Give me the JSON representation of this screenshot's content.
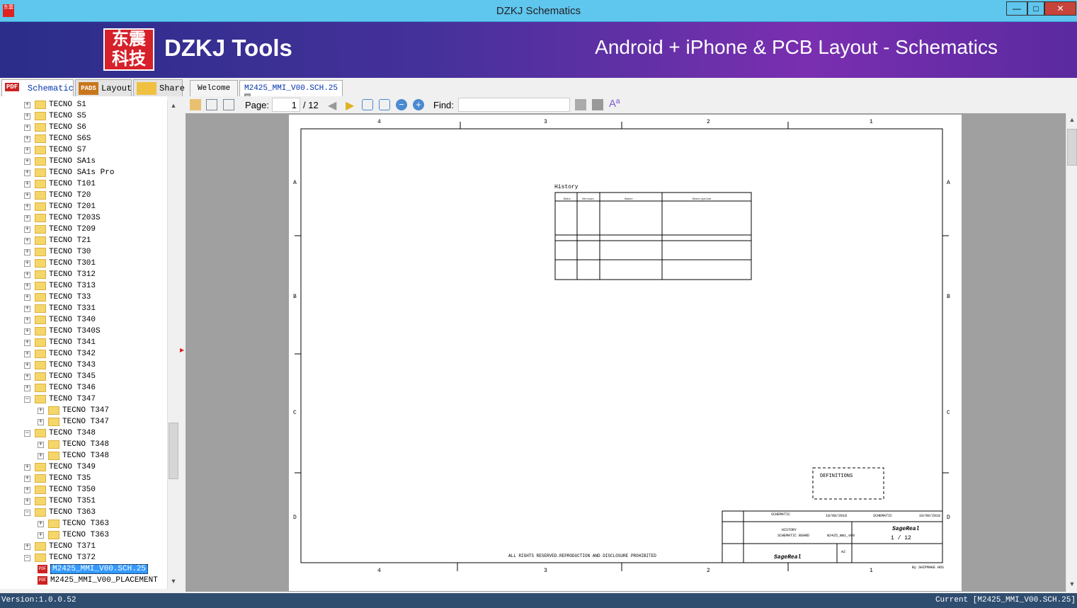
{
  "window": {
    "title": "DZKJ Schematics",
    "minimize": "—",
    "maximize": "□",
    "close": "✕"
  },
  "banner": {
    "logo_text": "东震科技",
    "brand": "DZKJ Tools",
    "tagline": "Android + iPhone & PCB Layout - Schematics"
  },
  "left_tabs": [
    {
      "label": "Schematic",
      "icon": "PDF"
    },
    {
      "label": "Layout",
      "icon": "PADS"
    },
    {
      "label": "Share",
      "icon": "cloud-plus"
    }
  ],
  "doc_tabs": [
    {
      "label": "Welcome"
    },
    {
      "label": "M2425_MMI_V00.SCH.25"
    }
  ],
  "tree": [
    {
      "label": "TECNO S1",
      "level": 0,
      "state": "+"
    },
    {
      "label": "TECNO S5",
      "level": 0,
      "state": "+"
    },
    {
      "label": "TECNO S6",
      "level": 0,
      "state": "+"
    },
    {
      "label": "TECNO S6S",
      "level": 0,
      "state": "+"
    },
    {
      "label": "TECNO S7",
      "level": 0,
      "state": "+"
    },
    {
      "label": "TECNO SA1s",
      "level": 0,
      "state": "+"
    },
    {
      "label": "TECNO SA1s Pro",
      "level": 0,
      "state": "+"
    },
    {
      "label": "TECNO T101",
      "level": 0,
      "state": "+"
    },
    {
      "label": "TECNO T20",
      "level": 0,
      "state": "+"
    },
    {
      "label": "TECNO T201",
      "level": 0,
      "state": "+"
    },
    {
      "label": "TECNO T203S",
      "level": 0,
      "state": "+"
    },
    {
      "label": "TECNO T209",
      "level": 0,
      "state": "+"
    },
    {
      "label": "TECNO T21",
      "level": 0,
      "state": "+"
    },
    {
      "label": "TECNO T30",
      "level": 0,
      "state": "+"
    },
    {
      "label": "TECNO T301",
      "level": 0,
      "state": "+"
    },
    {
      "label": "TECNO T312",
      "level": 0,
      "state": "+"
    },
    {
      "label": "TECNO T313",
      "level": 0,
      "state": "+"
    },
    {
      "label": "TECNO T33",
      "level": 0,
      "state": "+"
    },
    {
      "label": "TECNO T331",
      "level": 0,
      "state": "+"
    },
    {
      "label": "TECNO T340",
      "level": 0,
      "state": "+"
    },
    {
      "label": "TECNO T340S",
      "level": 0,
      "state": "+"
    },
    {
      "label": "TECNO T341",
      "level": 0,
      "state": "+"
    },
    {
      "label": "TECNO T342",
      "level": 0,
      "state": "+"
    },
    {
      "label": "TECNO T343",
      "level": 0,
      "state": "+"
    },
    {
      "label": "TECNO T345",
      "level": 0,
      "state": "+"
    },
    {
      "label": "TECNO T346",
      "level": 0,
      "state": "+"
    },
    {
      "label": "TECNO T347",
      "level": 0,
      "state": "-"
    },
    {
      "label": "TECNO T347",
      "level": 1,
      "state": "+"
    },
    {
      "label": "TECNO T347",
      "level": 1,
      "state": "+"
    },
    {
      "label": "TECNO T348",
      "level": 0,
      "state": "-"
    },
    {
      "label": "TECNO T348",
      "level": 1,
      "state": "+"
    },
    {
      "label": "TECNO T348",
      "level": 1,
      "state": "+"
    },
    {
      "label": "TECNO T349",
      "level": 0,
      "state": "+"
    },
    {
      "label": "TECNO T35",
      "level": 0,
      "state": "+"
    },
    {
      "label": "TECNO T350",
      "level": 0,
      "state": "+"
    },
    {
      "label": "TECNO T351",
      "level": 0,
      "state": "+"
    },
    {
      "label": "TECNO T363",
      "level": 0,
      "state": "-"
    },
    {
      "label": "TECNO T363",
      "level": 1,
      "state": "+"
    },
    {
      "label": "TECNO T363",
      "level": 1,
      "state": "+"
    },
    {
      "label": "TECNO T371",
      "level": 0,
      "state": "+"
    },
    {
      "label": "TECNO T372",
      "level": 0,
      "state": "-"
    },
    {
      "label": "M2425_MMI_V00.SCH.25",
      "level": 1,
      "state": "pdf",
      "selected": true
    },
    {
      "label": "M2425_MMI_V00_PLACEMENT",
      "level": 1,
      "state": "pdf"
    }
  ],
  "toolbar": {
    "page_label": "Page:",
    "page_value": "1",
    "page_total": "/ 12",
    "find_label": "Find:",
    "find_value": ""
  },
  "schematic": {
    "col_labels": [
      "4",
      "3",
      "2",
      "1"
    ],
    "row_labels": [
      "A",
      "B",
      "C",
      "D"
    ],
    "history_title": "History",
    "history_headers": [
      "Date",
      "Version",
      "Owner",
      "Description"
    ],
    "footer": "ALL RIGHTS RESERVED.REPRODUCTION AND DISCLOSURE PROHIBITED",
    "definitions": "DEFINITIONS",
    "title_block": {
      "name1": "SCHEMATIC",
      "date1": "18/08/2018",
      "name2": "SCHEMATIC",
      "date2": "18/08/2018",
      "title": "HISTORY",
      "product": "SCHEMATIC BOARD",
      "model": "m2425_mmi_v00",
      "sheet": "1 / 12",
      "format": "A2",
      "brand": "SageReal",
      "modified": "MODIFIED",
      "checked": "CHECKED",
      "name_label": "NAME",
      "date_label": "DATE",
      "title_label": "TITLE",
      "product_label": "Product Name",
      "pn_label": "P.N.",
      "pagesheet_label": "PAGE/SHEET",
      "format_label": "FORMAT SIZE",
      "docnum_label": "DOCUMENT NUMBER",
      "type_label": "TYPE",
      "part_label": "PART",
      "vers_label": "VERS.",
      "ver_label": "VER.",
      "date_col": "DATE",
      "by": "By SHIPMAKE HOS"
    }
  },
  "status": {
    "version": "Version:1.0.0.52",
    "current": "Current [M2425_MMI_V00.SCH.25]"
  }
}
